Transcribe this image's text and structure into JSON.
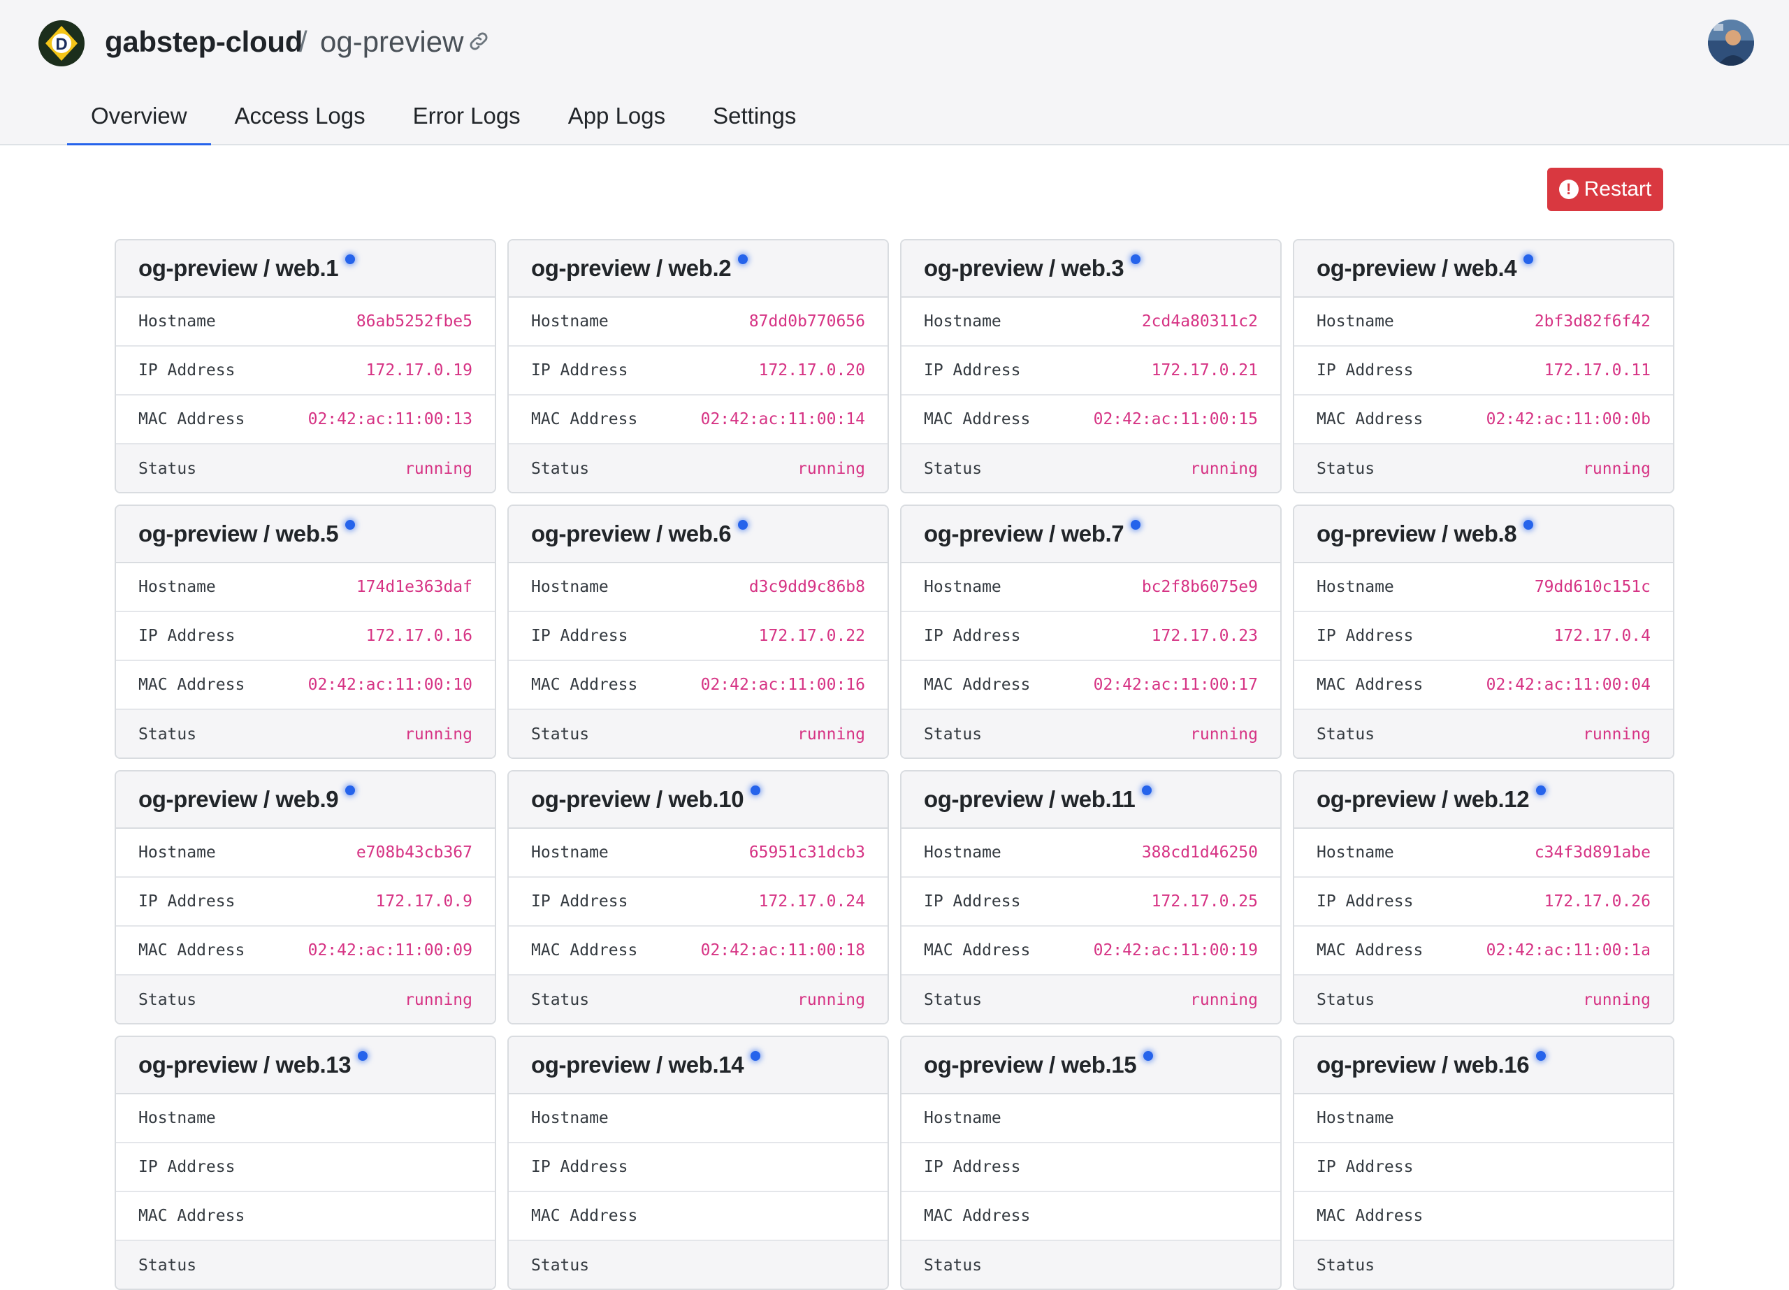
{
  "header": {
    "org": "gabstep-cloud",
    "separator": "/",
    "app": "og-preview"
  },
  "tabs": [
    "Overview",
    "Access Logs",
    "Error Logs",
    "App Logs",
    "Settings"
  ],
  "actions": {
    "restart_label": "Restart"
  },
  "field_labels": {
    "hostname": "Hostname",
    "ip": "IP Address",
    "mac": "MAC Address",
    "status": "Status"
  },
  "accent_color": "#2563eb",
  "danger_color": "#d93840",
  "value_color": "#d63384",
  "containers": [
    {
      "name": "og-preview / web.1",
      "hostname": "86ab5252fbe5",
      "ip": "172.17.0.19",
      "mac": "02:42:ac:11:00:13",
      "status": "running"
    },
    {
      "name": "og-preview / web.2",
      "hostname": "87dd0b770656",
      "ip": "172.17.0.20",
      "mac": "02:42:ac:11:00:14",
      "status": "running"
    },
    {
      "name": "og-preview / web.3",
      "hostname": "2cd4a80311c2",
      "ip": "172.17.0.21",
      "mac": "02:42:ac:11:00:15",
      "status": "running"
    },
    {
      "name": "og-preview / web.4",
      "hostname": "2bf3d82f6f42",
      "ip": "172.17.0.11",
      "mac": "02:42:ac:11:00:0b",
      "status": "running"
    },
    {
      "name": "og-preview / web.5",
      "hostname": "174d1e363daf",
      "ip": "172.17.0.16",
      "mac": "02:42:ac:11:00:10",
      "status": "running"
    },
    {
      "name": "og-preview / web.6",
      "hostname": "d3c9dd9c86b8",
      "ip": "172.17.0.22",
      "mac": "02:42:ac:11:00:16",
      "status": "running"
    },
    {
      "name": "og-preview / web.7",
      "hostname": "bc2f8b6075e9",
      "ip": "172.17.0.23",
      "mac": "02:42:ac:11:00:17",
      "status": "running"
    },
    {
      "name": "og-preview / web.8",
      "hostname": "79dd610c151c",
      "ip": "172.17.0.4",
      "mac": "02:42:ac:11:00:04",
      "status": "running"
    },
    {
      "name": "og-preview / web.9",
      "hostname": "e708b43cb367",
      "ip": "172.17.0.9",
      "mac": "02:42:ac:11:00:09",
      "status": "running"
    },
    {
      "name": "og-preview / web.10",
      "hostname": "65951c31dcb3",
      "ip": "172.17.0.24",
      "mac": "02:42:ac:11:00:18",
      "status": "running"
    },
    {
      "name": "og-preview / web.11",
      "hostname": "388cd1d46250",
      "ip": "172.17.0.25",
      "mac": "02:42:ac:11:00:19",
      "status": "running"
    },
    {
      "name": "og-preview / web.12",
      "hostname": "c34f3d891abe",
      "ip": "172.17.0.26",
      "mac": "02:42:ac:11:00:1a",
      "status": "running"
    },
    {
      "name": "og-preview / web.13",
      "hostname": "",
      "ip": "",
      "mac": "",
      "status": ""
    },
    {
      "name": "og-preview / web.14",
      "hostname": "",
      "ip": "",
      "mac": "",
      "status": ""
    },
    {
      "name": "og-preview / web.15",
      "hostname": "",
      "ip": "",
      "mac": "",
      "status": ""
    },
    {
      "name": "og-preview / web.16",
      "hostname": "",
      "ip": "",
      "mac": "",
      "status": ""
    }
  ]
}
